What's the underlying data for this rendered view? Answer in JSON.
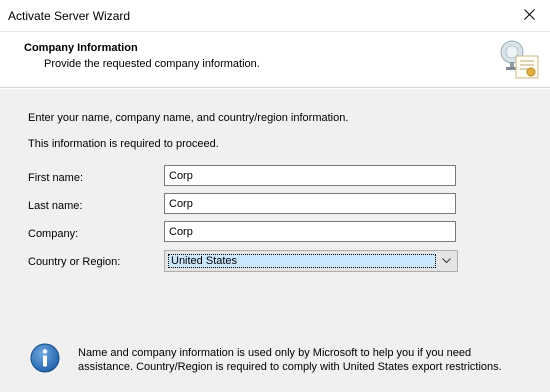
{
  "window": {
    "title": "Activate Server Wizard",
    "close_icon": "close-icon"
  },
  "header": {
    "title": "Company Information",
    "subtitle": "Provide the requested company information.",
    "icon": "certificate-icon"
  },
  "intro": {
    "line1": "Enter your name, company name, and country/region information.",
    "line2": "This information is required to proceed."
  },
  "form": {
    "first_name": {
      "label": "First name:",
      "value": "Corp"
    },
    "last_name": {
      "label": "Last name:",
      "value": "Corp"
    },
    "company": {
      "label": "Company:",
      "value": "Corp"
    },
    "country": {
      "label": "Country or Region:",
      "value": "United States"
    }
  },
  "info": {
    "icon": "info-icon",
    "text": "Name and company information is used only by Microsoft to help you if you need assistance. Country/Region is required to comply with United States export restrictions."
  },
  "colors": {
    "info_blue": "#1e5fa8",
    "selection": "#cce8ff"
  }
}
